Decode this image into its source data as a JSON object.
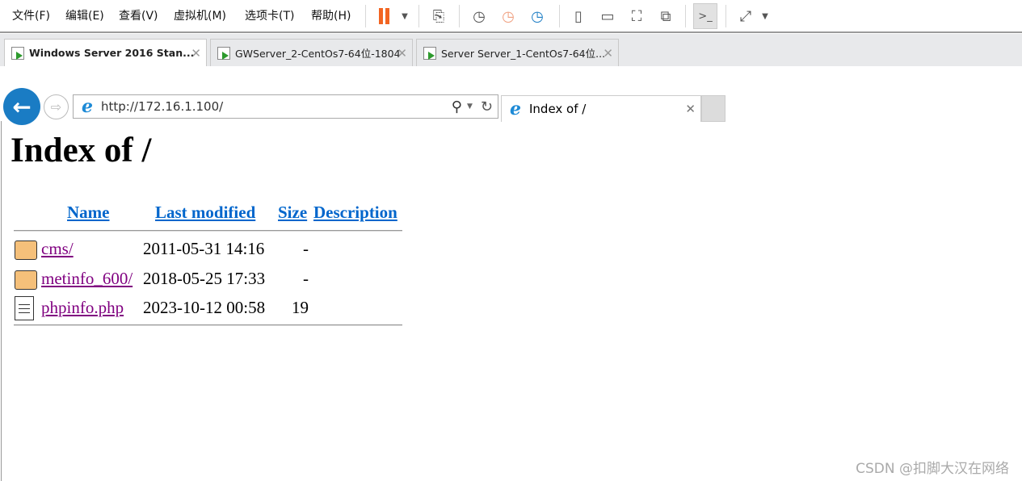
{
  "menu": [
    "文件(F)",
    "编辑(E)",
    "查看(V)",
    "虚拟机(M)",
    "选项卡(T)",
    "帮助(H)"
  ],
  "vm_tabs": [
    {
      "label": "Windows Server 2016 Stan...",
      "active": true
    },
    {
      "label": "GWServer_2-CentOs7-64位-1804",
      "active": false
    },
    {
      "label": "Server Server_1-CentOs7-64位...",
      "active": false
    }
  ],
  "browser": {
    "url": "http://172.16.1.100/",
    "tab_title": "Index of /"
  },
  "page": {
    "title": "Index of /",
    "headers": [
      "Name",
      "Last modified",
      "Size",
      "Description"
    ],
    "rows": [
      {
        "name": "cms/",
        "modified": "2011-05-31 14:16",
        "size": "-",
        "icon": "folder-icon"
      },
      {
        "name": "metinfo_600/",
        "modified": "2018-05-25 17:33",
        "size": "-",
        "icon": "folder-icon"
      },
      {
        "name": "phpinfo.php",
        "modified": "2023-10-12 00:58",
        "size": "19",
        "icon": "file-icon"
      }
    ]
  },
  "watermark": "CSDN @扣脚大汉在网络",
  "colors": {
    "pause": "#f26522",
    "link_header": "#0066cc",
    "link_visited": "#800080",
    "ie_back": "#1a7cc4"
  }
}
